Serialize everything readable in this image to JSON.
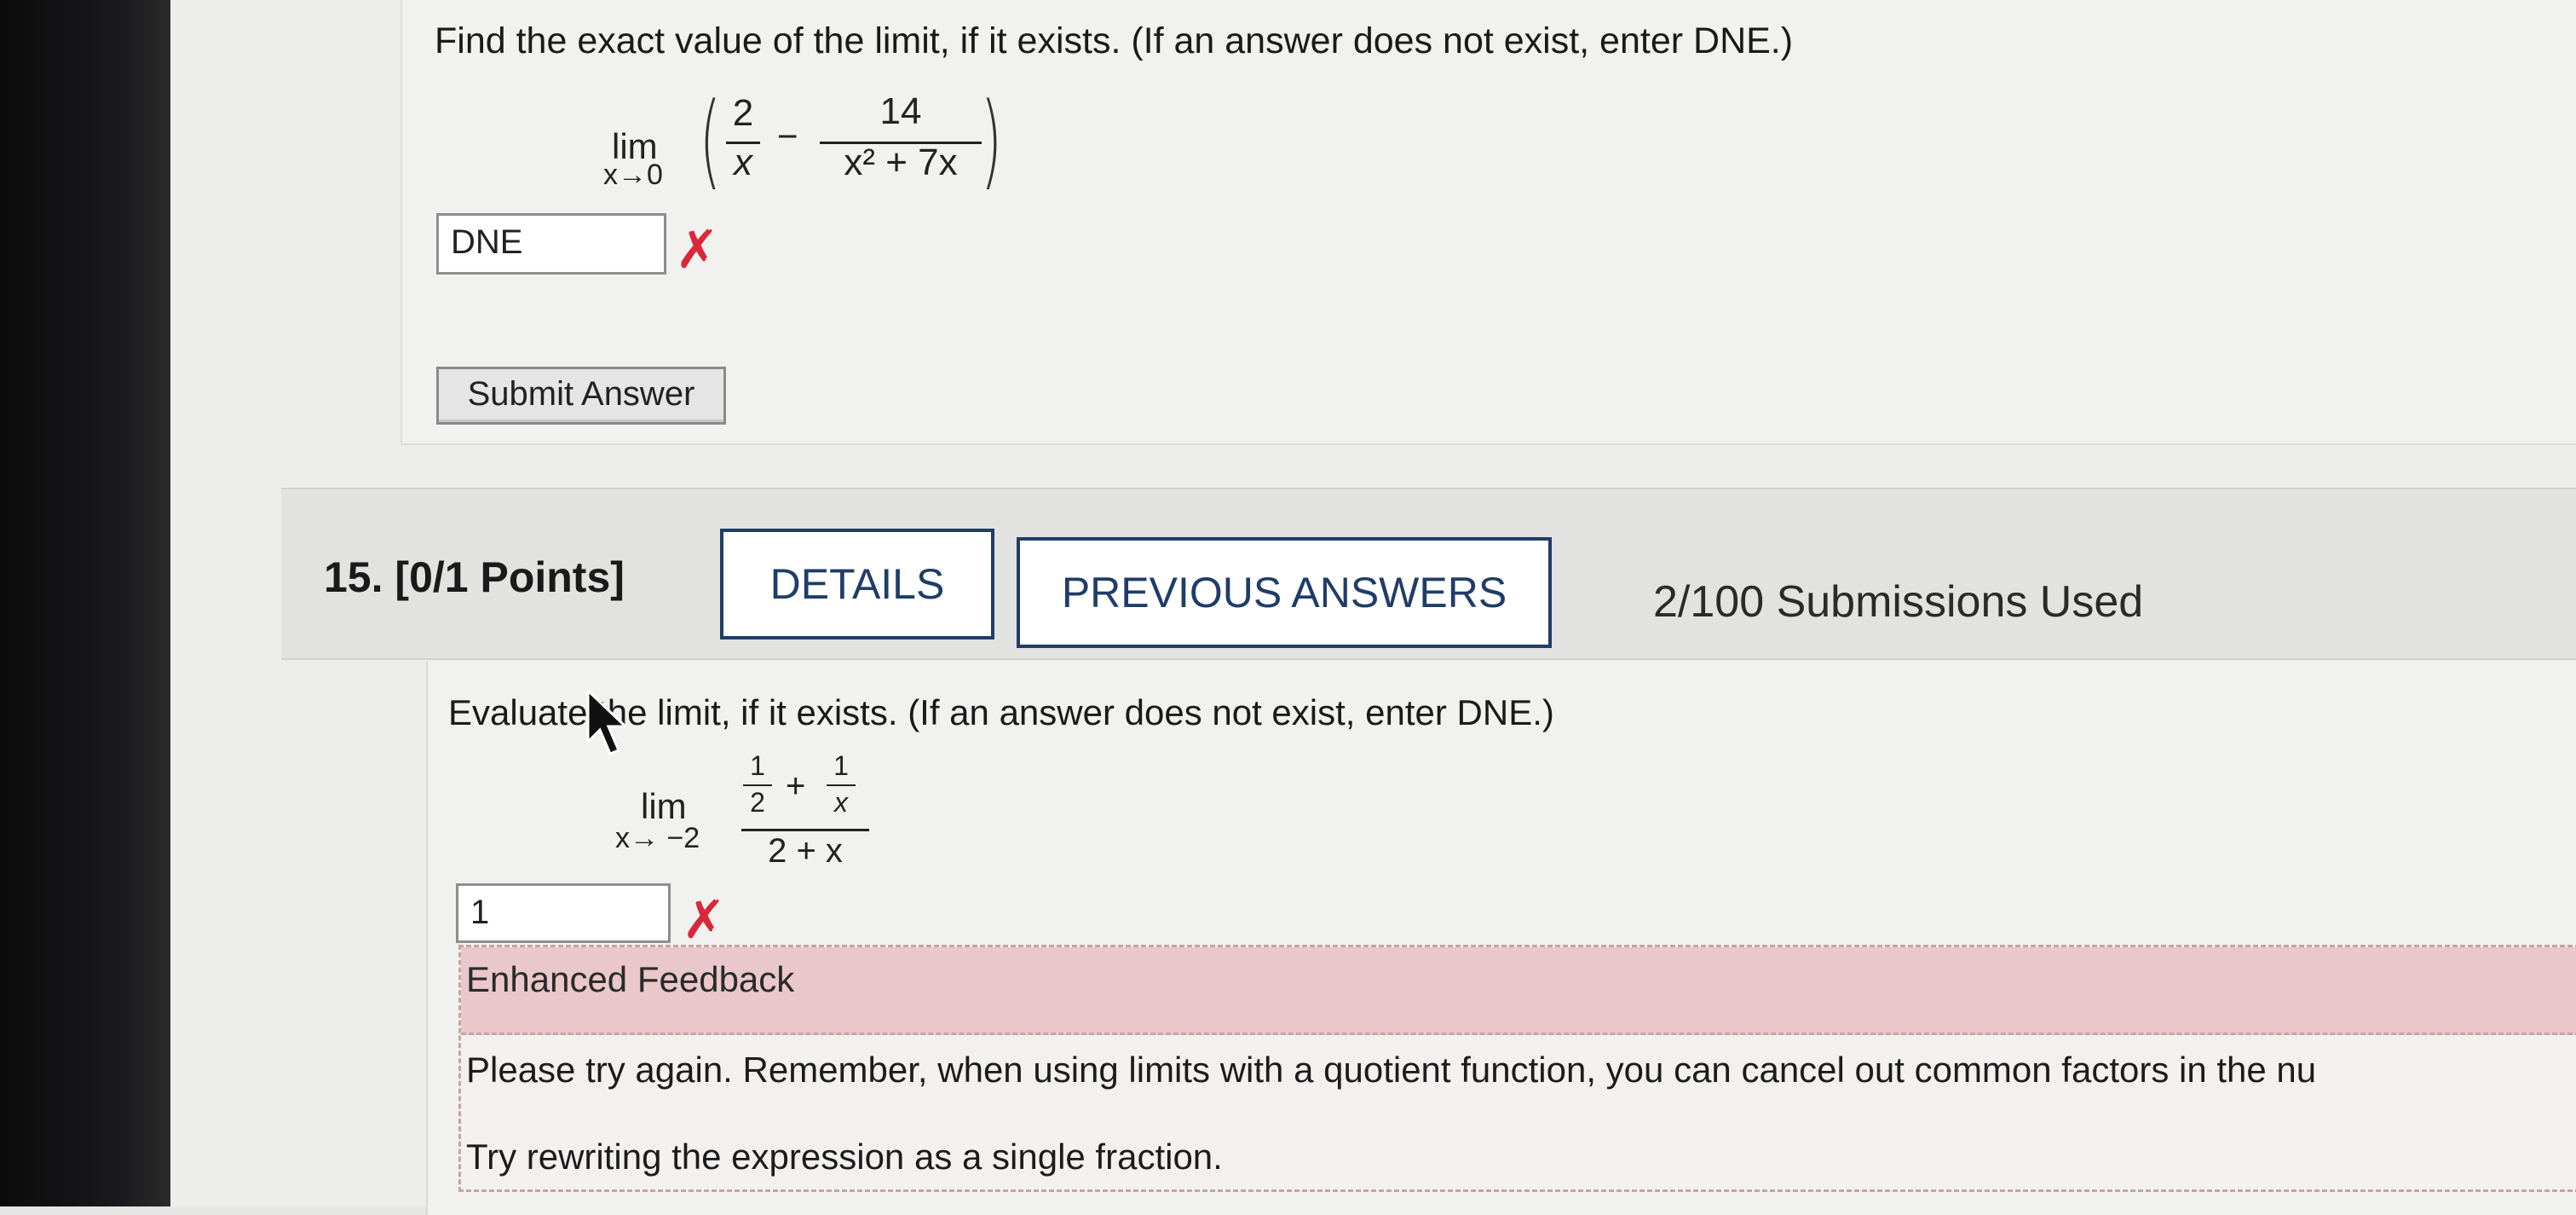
{
  "previous_question": {
    "prompt": "Find the exact value of the limit, if it exists. (If an answer does not exist, enter DNE.)",
    "limit_word": "lim",
    "limit_sub": "x→0",
    "term1_num": "2",
    "term1_den": "x",
    "minus": "−",
    "term2_num": "14",
    "term2_den": "x² + 7x",
    "answer_value": "DNE",
    "answer_status_icon": "x-mark-icon",
    "submit_label": "Submit Answer"
  },
  "question": {
    "number": "15.",
    "points": "[0/1 Points]",
    "details_label": "DETAILS",
    "previous_answers_label": "PREVIOUS ANSWERS",
    "submissions": "2/100 Submissions Used",
    "prompt": "Evaluate the limit, if it exists. (If an answer does not exist, enter DNE.)",
    "limit_word": "lim",
    "limit_sub": "x→ −2",
    "inner_a_num": "1",
    "inner_a_den": "2",
    "plus": "+",
    "inner_b_num": "1",
    "inner_b_den": "x",
    "outer_den": "2 + x",
    "answer_value": "1",
    "answer_status_icon": "x-mark-icon",
    "feedback_title": "Enhanced Feedback",
    "feedback_line1": "Please try again. Remember, when using limits with a quotient function, you can cancel out common factors in the nu",
    "feedback_line2": "Try rewriting the expression as a single fraction."
  },
  "colors": {
    "accent_blue": "#1f3d68",
    "error_red": "#d8283a",
    "feedback_pink": "#e9c7ca"
  }
}
